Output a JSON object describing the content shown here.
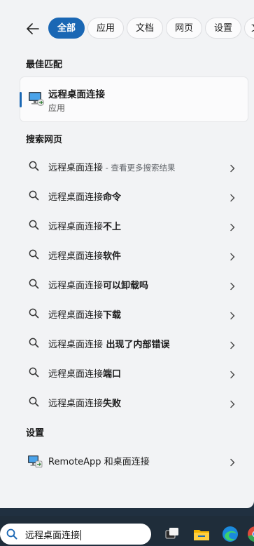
{
  "filters": [
    {
      "label": "全部",
      "active": true
    },
    {
      "label": "应用",
      "active": false
    },
    {
      "label": "文档",
      "active": false
    },
    {
      "label": "网页",
      "active": false
    },
    {
      "label": "设置",
      "active": false
    },
    {
      "label": "文",
      "active": false
    }
  ],
  "best_match": {
    "heading": "最佳匹配",
    "title": "远程桌面连接",
    "subtitle": "应用",
    "icon": "remote-desktop-icon"
  },
  "web": {
    "heading": "搜索网页",
    "items": [
      {
        "prefix": "远程桌面连接",
        "bold": "",
        "hint": " - 查看更多搜索结果"
      },
      {
        "prefix": "远程桌面连接",
        "bold": "命令",
        "hint": ""
      },
      {
        "prefix": "远程桌面连接",
        "bold": "不上",
        "hint": ""
      },
      {
        "prefix": "远程桌面连接",
        "bold": "软件",
        "hint": ""
      },
      {
        "prefix": "远程桌面连接",
        "bold": "可以卸载吗",
        "hint": ""
      },
      {
        "prefix": "远程桌面连接",
        "bold": "下载",
        "hint": ""
      },
      {
        "prefix": "远程桌面连接",
        "bold": " 出现了内部错误",
        "hint": ""
      },
      {
        "prefix": "远程桌面连接",
        "bold": "端口",
        "hint": ""
      },
      {
        "prefix": "远程桌面连接",
        "bold": "失败",
        "hint": ""
      }
    ]
  },
  "settings": {
    "heading": "设置",
    "items": [
      {
        "label": "RemoteApp 和桌面连接",
        "icon": "remoteapp-icon"
      }
    ]
  },
  "search_box": {
    "query": "远程桌面连接"
  },
  "taskbar": {
    "icons": [
      "task-view-icon",
      "file-explorer-icon",
      "edge-icon",
      "chrome-icon"
    ]
  },
  "colors": {
    "accent": "#1a67b4",
    "panel": "#f2f3f5",
    "taskbar": "#1f2d3a"
  }
}
